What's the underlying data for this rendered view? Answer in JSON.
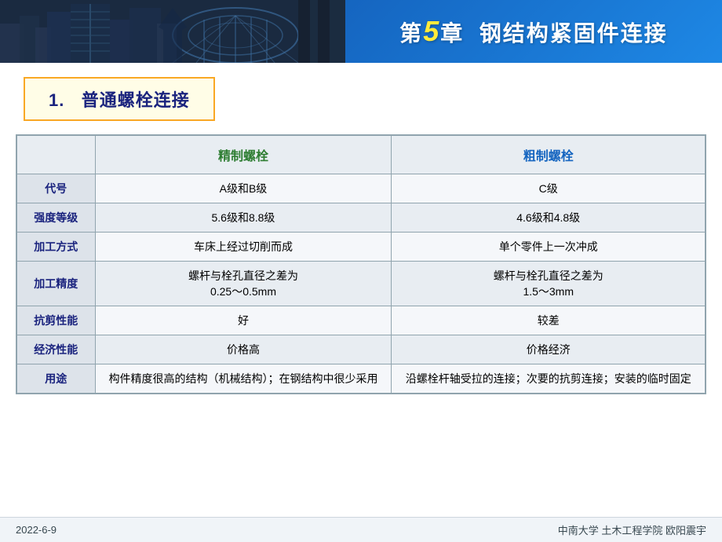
{
  "header": {
    "chapter": "5",
    "title_prefix": "第",
    "title_chapter_word": "章",
    "title_text": "钢结构紧固件连接",
    "image_alt": "建筑钢结构图片"
  },
  "section": {
    "number": "1.",
    "title": "普通螺栓连接"
  },
  "table": {
    "col_empty": "",
    "col_jingzhi": "精制螺栓",
    "col_cuzhi": "粗制螺栓",
    "rows": [
      {
        "label": "代号",
        "jingzhi": "A级和B级",
        "cuzhi": "C级"
      },
      {
        "label": "强度等级",
        "jingzhi": "5.6级和8.8级",
        "cuzhi": "4.6级和4.8级"
      },
      {
        "label": "加工方式",
        "jingzhi": "车床上经过切削而成",
        "cuzhi": "单个零件上一次冲成"
      },
      {
        "label": "加工精度",
        "jingzhi": "螺杆与栓孔直径之差为\n0.25～0.5mm",
        "cuzhi": "螺杆与栓孔直径之差为\n1.5～3mm"
      },
      {
        "label": "抗剪性能",
        "jingzhi": "好",
        "cuzhi": "较差"
      },
      {
        "label": "经济性能",
        "jingzhi": "价格高",
        "cuzhi": "价格经济"
      },
      {
        "label": "用途",
        "jingzhi": "构件精度很高的结构（机械结构）；在钢结构中很少采用",
        "cuzhi": "沿螺栓杆轴受拉的连接；次要的抗剪连接；安装的临时固定"
      }
    ]
  },
  "footer": {
    "date": "2022-6-9",
    "university": "中南大学  土木工程学院  欧阳震宇"
  }
}
